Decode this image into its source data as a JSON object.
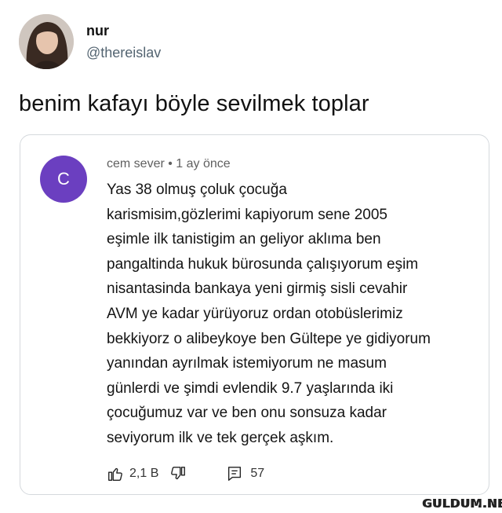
{
  "tweet": {
    "display_name": "nur",
    "handle": "@thereislav",
    "text": "benim kafayı böyle sevilmek toplar"
  },
  "comment": {
    "avatar_letter": "C",
    "avatar_color": "#6b3fc0",
    "meta": "cem sever • 1 ay önce",
    "lines": [
      "Yas 38 olmuş çoluk çocuğa",
      "karismisim,gözlerimi kapiyorum sene 2005",
      "eşimle ilk tanistigim an geliyor aklıma ben",
      "pangaltinda hukuk bürosunda çalışıyorum eşim",
      "nisantasinda bankaya yeni girmiş  sisli cevahir",
      "AVM ye kadar yürüyoruz ordan otobüslerimiz",
      "bekkiyorz o alibeykoye ben Gültepe ye gidiyorum",
      "yanından ayrılmak istemiyorum ne masum",
      "günlerdi ve şimdi evlendik 9.7 yaşlarında iki",
      "çocuğumuz var ve ben onu sonsuza kadar",
      "seviyorum ilk ve tek gerçek aşkım."
    ],
    "like_count": "2,1 B",
    "reply_count": "57",
    "icons": [
      "thumbs-up-icon",
      "thumbs-down-icon",
      "comment-icon"
    ]
  },
  "watermark": "GULDUM.NET"
}
